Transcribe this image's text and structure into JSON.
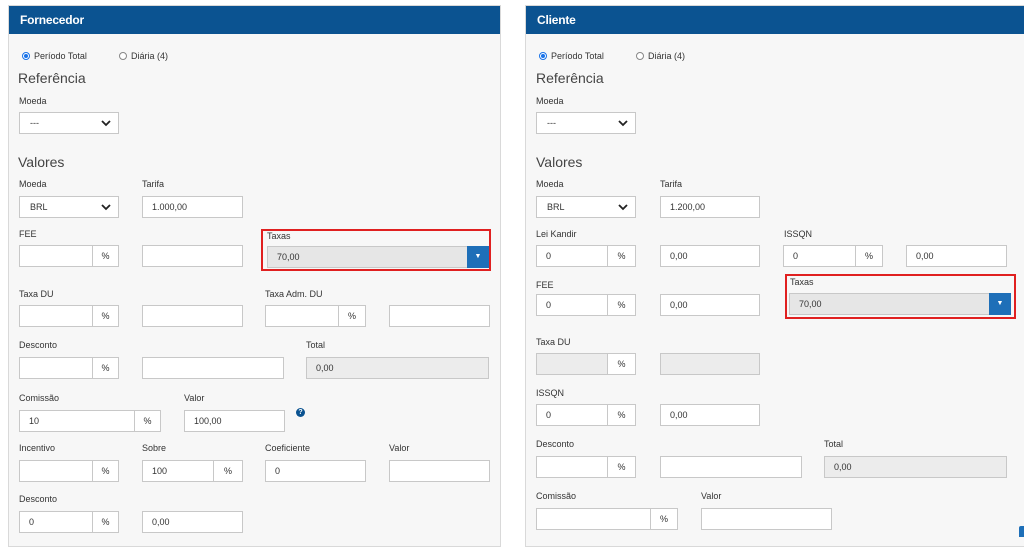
{
  "fornecedor": {
    "title": "Fornecedor",
    "radio_total": "Período Total",
    "radio_diaria": "Diária (4)",
    "referencia": "Referência",
    "ref_moeda_label": "Moeda",
    "ref_moeda_value": "---",
    "valores": "Valores",
    "moeda_label": "Moeda",
    "moeda_value": "BRL",
    "tarifa_label": "Tarifa",
    "tarifa_value": "1.000,00",
    "fee_label": "FEE",
    "fee_value": "",
    "fee_pct": "%",
    "fee_amount": "",
    "taxas_label": "Taxas",
    "taxas_value": "70,00",
    "taxas_btn": "▼",
    "taxa_du_label": "Taxa DU",
    "taxa_du_pct": "%",
    "taxa_adm_label": "Taxa Adm. DU",
    "taxa_adm_pct": "%",
    "desconto_label": "Desconto",
    "desconto_pct": "%",
    "total_label": "Total",
    "total_value": "0,00",
    "comissao_label": "Comissão",
    "comissao_value": "10",
    "comissao_pct": "%",
    "valor_label": "Valor",
    "valor_value": "100,00",
    "help": "?",
    "incentivo_label": "Incentivo",
    "incentivo_pct": "%",
    "sobre_label": "Sobre",
    "sobre_value": "100",
    "sobre_pct": "%",
    "coeficiente_label": "Coeficiente",
    "coeficiente_value": "0",
    "valor2_label": "Valor",
    "desconto2_label": "Desconto",
    "desconto2_value": "0",
    "desconto2_pct": "%",
    "desconto2_amount": "0,00"
  },
  "cliente": {
    "title": "Cliente",
    "radio_total": "Período Total",
    "radio_diaria": "Diária (4)",
    "referencia": "Referência",
    "ref_moeda_label": "Moeda",
    "ref_moeda_value": "---",
    "valores": "Valores",
    "moeda_label": "Moeda",
    "moeda_value": "BRL",
    "tarifa_label": "Tarifa",
    "tarifa_value": "1.200,00",
    "lei_kandir_label": "Lei Kandir",
    "lei_kandir_value": "0",
    "lei_kandir_pct": "%",
    "lei_kandir_amount": "0,00",
    "issqn_top_label": "ISSQN",
    "issqn_top_value": "0",
    "issqn_top_pct": "%",
    "issqn_top_amount": "0,00",
    "fee_label": "FEE",
    "fee_value": "0",
    "fee_pct": "%",
    "fee_amount": "0,00",
    "taxas_label": "Taxas",
    "taxas_value": "70,00",
    "taxas_btn": "▼",
    "taxa_du_label": "Taxa DU",
    "taxa_du_pct": "%",
    "issqn_label": "ISSQN",
    "issqn_value": "0",
    "issqn_pct": "%",
    "issqn_amount": "0,00",
    "desconto_label": "Desconto",
    "desconto_pct": "%",
    "total_label": "Total",
    "total_value": "0,00",
    "comissao_label": "Comissão",
    "comissao_pct": "%",
    "valor_label": "Valor"
  },
  "colors": {
    "header": "#0b5391",
    "button": "#1e6fb8",
    "highlight": "#e02020"
  }
}
